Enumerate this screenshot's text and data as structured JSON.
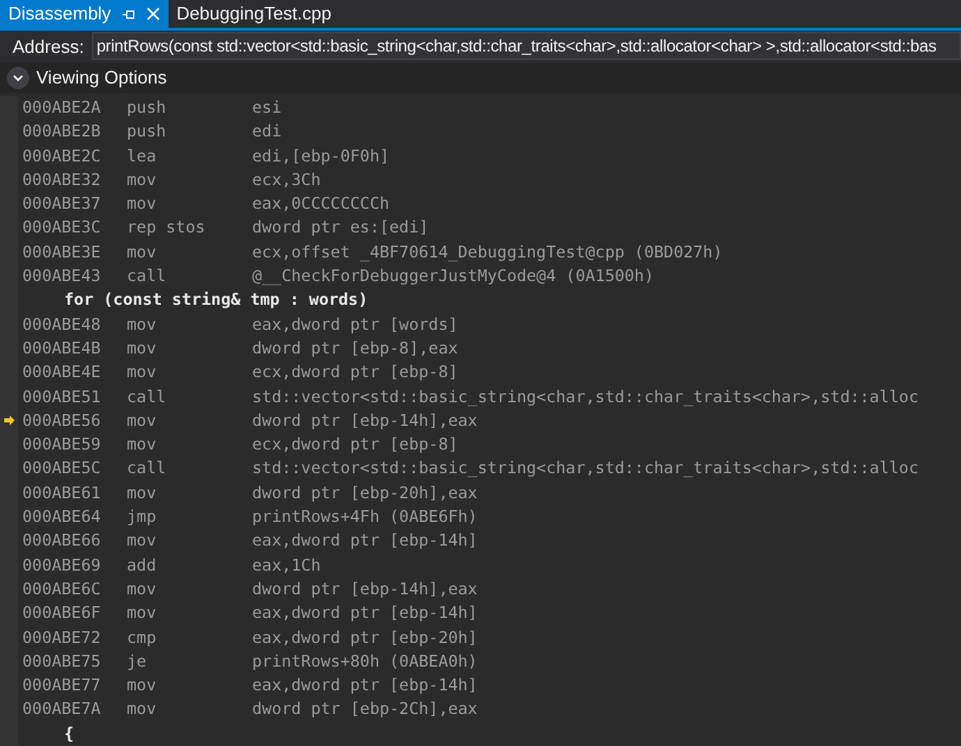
{
  "tabs": [
    {
      "label": "Disassembly",
      "selected": true,
      "pinned": true,
      "closable": true
    },
    {
      "label": "DebuggingTest.cpp",
      "selected": false,
      "pinned": false,
      "closable": false
    }
  ],
  "address_bar": {
    "label": "Address:",
    "value": "printRows(const std::vector<std::basic_string<char,std::char_traits<char>,std::allocator<char> >,std::allocator<std::bas"
  },
  "viewing_options": {
    "label": "Viewing Options",
    "expanded": false
  },
  "lines": [
    {
      "kind": "asm",
      "address": "000ABE2A",
      "mnemonic": "push",
      "operands": "esi",
      "current": false
    },
    {
      "kind": "asm",
      "address": "000ABE2B",
      "mnemonic": "push",
      "operands": "edi",
      "current": false
    },
    {
      "kind": "asm",
      "address": "000ABE2C",
      "mnemonic": "lea",
      "operands": "edi,[ebp-0F0h]",
      "current": false
    },
    {
      "kind": "asm",
      "address": "000ABE32",
      "mnemonic": "mov",
      "operands": "ecx,3Ch",
      "current": false
    },
    {
      "kind": "asm",
      "address": "000ABE37",
      "mnemonic": "mov",
      "operands": "eax,0CCCCCCCCh",
      "current": false
    },
    {
      "kind": "asm",
      "address": "000ABE3C",
      "mnemonic": "rep stos",
      "operands": "dword ptr es:[edi]",
      "current": false
    },
    {
      "kind": "asm",
      "address": "000ABE3E",
      "mnemonic": "mov",
      "operands": "ecx,offset _4BF70614_DebuggingTest@cpp (0BD027h)",
      "current": false
    },
    {
      "kind": "asm",
      "address": "000ABE43",
      "mnemonic": "call",
      "operands": "@__CheckForDebuggerJustMyCode@4 (0A1500h)",
      "current": false
    },
    {
      "kind": "source",
      "text": "for (const string& tmp : words)"
    },
    {
      "kind": "asm",
      "address": "000ABE48",
      "mnemonic": "mov",
      "operands": "eax,dword ptr [words]",
      "current": false
    },
    {
      "kind": "asm",
      "address": "000ABE4B",
      "mnemonic": "mov",
      "operands": "dword ptr [ebp-8],eax",
      "current": false
    },
    {
      "kind": "asm",
      "address": "000ABE4E",
      "mnemonic": "mov",
      "operands": "ecx,dword ptr [ebp-8]",
      "current": false
    },
    {
      "kind": "asm",
      "address": "000ABE51",
      "mnemonic": "call",
      "operands": "std::vector<std::basic_string<char,std::char_traits<char>,std::alloc",
      "current": false
    },
    {
      "kind": "asm",
      "address": "000ABE56",
      "mnemonic": "mov",
      "operands": "dword ptr [ebp-14h],eax",
      "current": true
    },
    {
      "kind": "asm",
      "address": "000ABE59",
      "mnemonic": "mov",
      "operands": "ecx,dword ptr [ebp-8]",
      "current": false
    },
    {
      "kind": "asm",
      "address": "000ABE5C",
      "mnemonic": "call",
      "operands": "std::vector<std::basic_string<char,std::char_traits<char>,std::alloc",
      "current": false
    },
    {
      "kind": "asm",
      "address": "000ABE61",
      "mnemonic": "mov",
      "operands": "dword ptr [ebp-20h],eax",
      "current": false
    },
    {
      "kind": "asm",
      "address": "000ABE64",
      "mnemonic": "jmp",
      "operands": "printRows+4Fh (0ABE6Fh)",
      "current": false
    },
    {
      "kind": "asm",
      "address": "000ABE66",
      "mnemonic": "mov",
      "operands": "eax,dword ptr [ebp-14h]",
      "current": false
    },
    {
      "kind": "asm",
      "address": "000ABE69",
      "mnemonic": "add",
      "operands": "eax,1Ch",
      "current": false
    },
    {
      "kind": "asm",
      "address": "000ABE6C",
      "mnemonic": "mov",
      "operands": "dword ptr [ebp-14h],eax",
      "current": false
    },
    {
      "kind": "asm",
      "address": "000ABE6F",
      "mnemonic": "mov",
      "operands": "eax,dword ptr [ebp-14h]",
      "current": false
    },
    {
      "kind": "asm",
      "address": "000ABE72",
      "mnemonic": "cmp",
      "operands": "eax,dword ptr [ebp-20h]",
      "current": false
    },
    {
      "kind": "asm",
      "address": "000ABE75",
      "mnemonic": "je",
      "operands": "printRows+80h (0ABEA0h)",
      "current": false
    },
    {
      "kind": "asm",
      "address": "000ABE77",
      "mnemonic": "mov",
      "operands": "eax,dword ptr [ebp-14h]",
      "current": false
    },
    {
      "kind": "asm",
      "address": "000ABE7A",
      "mnemonic": "mov",
      "operands": "dword ptr [ebp-2Ch],eax",
      "current": false
    },
    {
      "kind": "source",
      "text": "{"
    }
  ]
}
